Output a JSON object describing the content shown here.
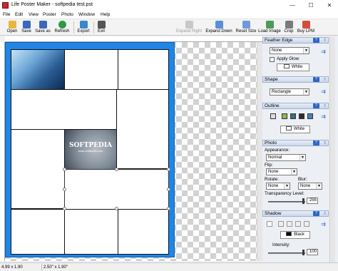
{
  "window": {
    "title": "Life Poster Maker - softpedia test.pst",
    "controls": [
      "—",
      "☐",
      "✕"
    ]
  },
  "menu": [
    "File",
    "Edit",
    "View",
    "Poster",
    "Photo",
    "Window",
    "Help"
  ],
  "toolbar": {
    "left": [
      {
        "label": "Open",
        "icon": "folder-open-icon",
        "color": "#e7b73e"
      },
      {
        "label": "Save",
        "icon": "save-icon",
        "color": "#3b68b8"
      },
      {
        "label": "Save as",
        "icon": "save-as-icon",
        "color": "#3b68b8"
      },
      {
        "label": "Refresh",
        "icon": "refresh-icon",
        "color": "#2e9a45"
      },
      {
        "label": "Export",
        "icon": "export-icon",
        "color": "#3a86cf"
      },
      {
        "label": "Exit",
        "icon": "exit-icon",
        "color": "#555555"
      }
    ],
    "right": [
      {
        "label": "Expand Right",
        "icon": "expand-right-icon",
        "disabled": true
      },
      {
        "label": "Expand Down",
        "icon": "expand-down-icon",
        "disabled": false
      },
      {
        "label": "Reset Size",
        "icon": "reset-size-icon",
        "disabled": false
      },
      {
        "label": "Load Image",
        "icon": "load-image-icon",
        "disabled": false
      },
      {
        "label": "Crop",
        "icon": "crop-icon",
        "disabled": false
      },
      {
        "label": "Buy LPM",
        "icon": "buy-icon",
        "disabled": false
      }
    ]
  },
  "canvas": {
    "photo2_text": "SOFTPEDIA",
    "photo2_sub": "www.softpedia.com"
  },
  "panel": {
    "feather": {
      "title": "Feather Edge",
      "value": "None",
      "glow_label": "Apply Glow",
      "glow_checked": false,
      "glow_color": "White"
    },
    "shape": {
      "title": "Shape",
      "value": "Rectangle"
    },
    "outline": {
      "title": "Outline",
      "color": "White"
    },
    "photo": {
      "title": "Photo",
      "appearance_label": "Appearance:",
      "appearance": "Normal",
      "flip_label": "Flip:",
      "flip": "None",
      "rotate_label": "Rotate:",
      "rotate": "None",
      "blur_label": "Blur:",
      "blur": "None",
      "transparency_label": "Transparency Level:",
      "transparency": "255"
    },
    "shadow": {
      "title": "Shadow",
      "color": "Black",
      "intensity_label": "Intensity:",
      "intensity": "100"
    }
  },
  "status": {
    "size": "4.99 x 1.90",
    "dims": "2.50\" x 1.90\""
  },
  "colors": {
    "poster_blue": "#1f86e6",
    "panel_bg": "#eceff4",
    "accent": "#2e67c6"
  }
}
